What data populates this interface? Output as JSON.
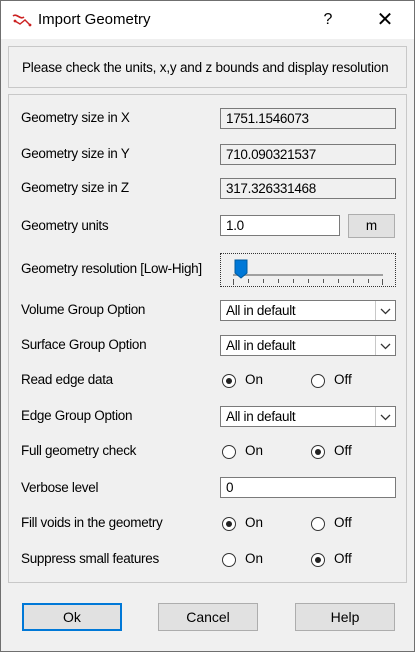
{
  "window": {
    "title": "Import Geometry",
    "help_glyph": "?",
    "close_glyph": "✕"
  },
  "info": "Please check the units, x,y and z bounds and display resolution",
  "fields": {
    "size_x": {
      "label": "Geometry size in X",
      "value": "1751.1546073"
    },
    "size_y": {
      "label": "Geometry size in Y",
      "value": "710.090321537"
    },
    "size_z": {
      "label": "Geometry size in Z",
      "value": "317.326331468"
    },
    "units": {
      "label": "Geometry units",
      "value": "1.0",
      "unit_button": "m"
    },
    "resolution": {
      "label": "Geometry resolution [Low-High]",
      "level": 0.03
    },
    "volume_group": {
      "label": "Volume Group Option",
      "value": "All in default"
    },
    "surface_group": {
      "label": "Surface Group Option",
      "value": "All in default"
    },
    "read_edge": {
      "label": "Read edge data",
      "on": "On",
      "off": "Off",
      "selected": "On"
    },
    "edge_group": {
      "label": "Edge Group Option",
      "value": "All in default"
    },
    "full_check": {
      "label": "Full geometry check",
      "on": "On",
      "off": "Off",
      "selected": "Off"
    },
    "verbose": {
      "label": "Verbose level",
      "value": "0"
    },
    "fill_voids": {
      "label": "Fill voids in the geometry",
      "on": "On",
      "off": "Off",
      "selected": "On"
    },
    "suppress_small": {
      "label": "Suppress small features",
      "on": "On",
      "off": "Off",
      "selected": "Off"
    }
  },
  "buttons": {
    "ok": "Ok",
    "cancel": "Cancel",
    "help": "Help"
  },
  "icons": {
    "app": "import-geometry-icon",
    "dropdown": "chevron-down-icon"
  },
  "colors": {
    "accent": "#0078d7",
    "icon_red": "#cc2222"
  }
}
